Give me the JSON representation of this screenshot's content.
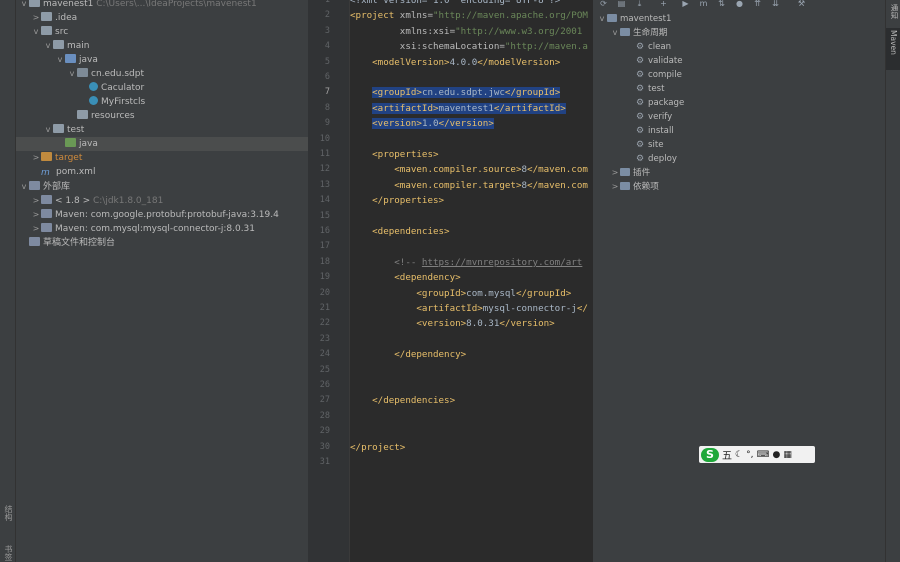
{
  "project_panel": {
    "rows": [
      {
        "name": "mavenest1",
        "suffix": "C:\\Users\\...\\IdeaProjects\\mavenest1",
        "arrow": "v",
        "icon": "folder",
        "indent": 0
      },
      {
        "name": ".idea",
        "arrow": ">",
        "icon": "folder",
        "indent": 1
      },
      {
        "name": "src",
        "arrow": "v",
        "icon": "folder",
        "indent": 1
      },
      {
        "name": "main",
        "arrow": "v",
        "icon": "folder",
        "indent": 2
      },
      {
        "name": "java",
        "arrow": "v",
        "icon": "folder-blue",
        "indent": 3
      },
      {
        "name": "cn.edu.sdpt",
        "arrow": "v",
        "icon": "pkg",
        "indent": 4
      },
      {
        "name": "Caculator",
        "arrow": "",
        "icon": "class",
        "indent": 5
      },
      {
        "name": "MyFirstcls",
        "arrow": "",
        "icon": "class",
        "indent": 5
      },
      {
        "name": "resources",
        "arrow": "",
        "icon": "folder",
        "indent": 4
      },
      {
        "name": "test",
        "arrow": "v",
        "icon": "folder",
        "indent": 2
      },
      {
        "name": "java",
        "arrow": "",
        "icon": "folder-green",
        "indent": 3,
        "selected": true
      },
      {
        "name": "target",
        "arrow": ">",
        "icon": "folder-orange",
        "indent": 1,
        "orange": true
      },
      {
        "name": "pom.xml",
        "arrow": "",
        "icon": "pom",
        "indent": 1
      },
      {
        "name": "外部库",
        "arrow": "v",
        "icon": "lib",
        "indent": 0
      },
      {
        "name": "< 1.8 >",
        "suffix": "C:\\jdk1.8.0_181",
        "arrow": ">",
        "icon": "lib",
        "indent": 1
      },
      {
        "name": "Maven: com.google.protobuf:protobuf-java:3.19.4",
        "arrow": ">",
        "icon": "lib",
        "indent": 1
      },
      {
        "name": "Maven: com.mysql:mysql-connector-j:8.0.31",
        "arrow": ">",
        "icon": "lib",
        "indent": 1
      },
      {
        "name": "草稿文件和控制台",
        "arrow": "",
        "icon": "lib",
        "indent": 0
      }
    ]
  },
  "left_strip": {
    "label_structure": "结构",
    "label_bookmarks": "书签"
  },
  "editor": {
    "current_line": 7,
    "lines": [
      {
        "n": 1,
        "segs": [
          {
            "c": "txt",
            "t": "<?xml version=\"1.0\" encoding=\"UTF-8\"?>"
          }
        ]
      },
      {
        "n": 2,
        "segs": [
          {
            "c": "tag",
            "t": "<project "
          },
          {
            "c": "attr",
            "t": "xmlns="
          },
          {
            "c": "val",
            "t": "\"http://maven.apache.org/POM"
          }
        ]
      },
      {
        "n": 3,
        "segs": [
          {
            "c": "attr",
            "t": "         xmlns:xsi="
          },
          {
            "c": "val",
            "t": "\"http://www.w3.org/2001"
          }
        ]
      },
      {
        "n": 4,
        "segs": [
          {
            "c": "attr",
            "t": "         xsi:schemaLocation="
          },
          {
            "c": "val",
            "t": "\"http://maven.a"
          }
        ]
      },
      {
        "n": 5,
        "segs": [
          {
            "c": "tag",
            "t": "    <modelVersion>"
          },
          {
            "c": "txt",
            "t": "4.0.0"
          },
          {
            "c": "tag",
            "t": "</modelVersion>"
          }
        ]
      },
      {
        "n": 6,
        "segs": []
      },
      {
        "n": 7,
        "hl": true,
        "segs": [
          {
            "c": "tag",
            "t": "    <groupId>"
          },
          {
            "c": "txt",
            "t": "cn.edu.sdpt.jwc"
          },
          {
            "c": "tag",
            "t": "</groupId>"
          }
        ]
      },
      {
        "n": 8,
        "hl": true,
        "segs": [
          {
            "c": "tag",
            "t": "    <artifactId>"
          },
          {
            "c": "txt",
            "t": "maventest1"
          },
          {
            "c": "tag",
            "t": "</artifactId>"
          }
        ]
      },
      {
        "n": 9,
        "hl": true,
        "segs": [
          {
            "c": "tag",
            "t": "    <version>"
          },
          {
            "c": "txt",
            "t": "1.0"
          },
          {
            "c": "tag",
            "t": "</version>"
          }
        ]
      },
      {
        "n": 10,
        "segs": []
      },
      {
        "n": 11,
        "segs": [
          {
            "c": "tag",
            "t": "    <properties>"
          }
        ]
      },
      {
        "n": 12,
        "segs": [
          {
            "c": "tag",
            "t": "        <maven.compiler.source>"
          },
          {
            "c": "txt",
            "t": "8"
          },
          {
            "c": "tag",
            "t": "</maven.com"
          }
        ]
      },
      {
        "n": 13,
        "segs": [
          {
            "c": "tag",
            "t": "        <maven.compiler.target>"
          },
          {
            "c": "txt",
            "t": "8"
          },
          {
            "c": "tag",
            "t": "</maven.com"
          }
        ]
      },
      {
        "n": 14,
        "segs": [
          {
            "c": "tag",
            "t": "    </properties>"
          }
        ]
      },
      {
        "n": 15,
        "segs": []
      },
      {
        "n": 16,
        "segs": [
          {
            "c": "tag",
            "t": "    <dependencies>"
          }
        ]
      },
      {
        "n": 17,
        "segs": []
      },
      {
        "n": 18,
        "segs": [
          {
            "c": "cmt",
            "t": "        <!-- "
          },
          {
            "c": "lnk",
            "t": "https://mvnrepository.com/art"
          }
        ]
      },
      {
        "n": 19,
        "segs": [
          {
            "c": "tag",
            "t": "        <dependency>"
          }
        ]
      },
      {
        "n": 20,
        "segs": [
          {
            "c": "tag",
            "t": "            <groupId>"
          },
          {
            "c": "txt",
            "t": "com.mysql"
          },
          {
            "c": "tag",
            "t": "</groupId>"
          }
        ]
      },
      {
        "n": 21,
        "segs": [
          {
            "c": "tag",
            "t": "            <artifactId>"
          },
          {
            "c": "txt",
            "t": "mysql-connector-j"
          },
          {
            "c": "tag",
            "t": "</"
          }
        ]
      },
      {
        "n": 22,
        "segs": [
          {
            "c": "tag",
            "t": "            <version>"
          },
          {
            "c": "txt",
            "t": "8.0.31"
          },
          {
            "c": "tag",
            "t": "</version>"
          }
        ]
      },
      {
        "n": 23,
        "segs": []
      },
      {
        "n": 24,
        "segs": [
          {
            "c": "tag",
            "t": "        </dependency>"
          }
        ]
      },
      {
        "n": 25,
        "segs": []
      },
      {
        "n": 26,
        "segs": []
      },
      {
        "n": 27,
        "segs": [
          {
            "c": "tag",
            "t": "    </dependencies>"
          }
        ]
      },
      {
        "n": 28,
        "segs": []
      },
      {
        "n": 29,
        "segs": []
      },
      {
        "n": 30,
        "segs": [
          {
            "c": "tag",
            "t": "</project>"
          }
        ]
      },
      {
        "n": 31,
        "segs": []
      }
    ]
  },
  "maven_panel": {
    "project": "maventest1",
    "lifecycle_label": "生命周期",
    "phases": [
      "clean",
      "validate",
      "compile",
      "test",
      "package",
      "verify",
      "install",
      "site",
      "deploy"
    ],
    "plugins_label": "插件",
    "dependencies_label": "依赖项"
  },
  "right_strip": {
    "label_notifications": "通知",
    "label_maven": "Maven"
  },
  "ime": {
    "logo": "S",
    "mode": "五",
    "icons": [
      "moon-icon",
      "punctuation-icon",
      "keyboard-icon",
      "user-icon",
      "grid-icon"
    ]
  }
}
